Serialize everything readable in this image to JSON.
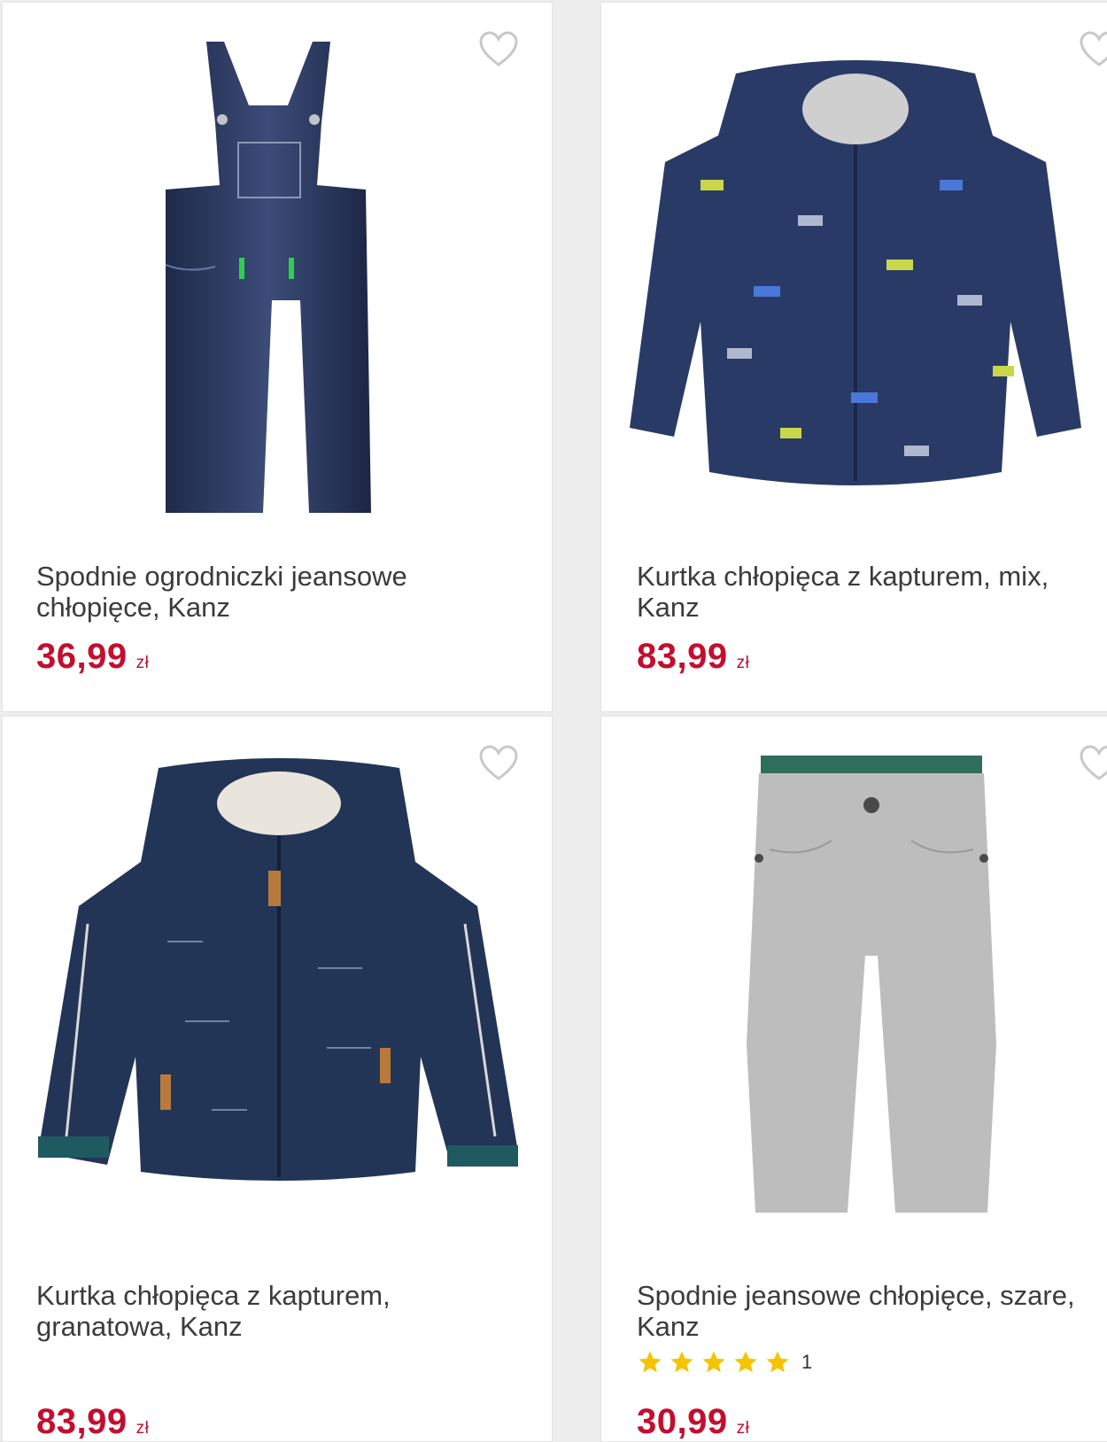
{
  "products": [
    {
      "title_l1": "Spodnie ogrodniczki jeansowe",
      "title_l2": "chłopięce, Kanz",
      "price": "36,99",
      "currency": "zł",
      "favorite_icon": "heart-outline-icon"
    },
    {
      "title_l1": "Kurtka chłopięca z kapturem, mix,",
      "title_l2": "Kanz",
      "price": "83,99",
      "currency": "zł",
      "favorite_icon": "heart-outline-icon"
    },
    {
      "title_l1": "Kurtka chłopięca z kapturem,",
      "title_l2": "granatowa, Kanz",
      "price": "83,99",
      "currency": "zł",
      "favorite_icon": "heart-outline-icon"
    },
    {
      "title_l1": "Spodnie jeansowe chłopięce, szare,",
      "title_l2": "Kanz",
      "price": "30,99",
      "currency": "zł",
      "rating_count": "1",
      "rating_stars": 5,
      "favorite_icon": "heart-outline-icon"
    }
  ],
  "colors": {
    "price": "#c30e2e",
    "star": "#f5c300",
    "title": "#3b3b3b"
  }
}
